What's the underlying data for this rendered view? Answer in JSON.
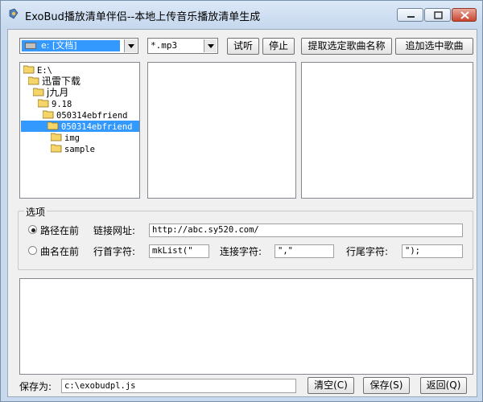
{
  "window": {
    "title": "ExoBud播放清单伴侣--本地上传音乐播放清单生成"
  },
  "toolbar": {
    "drive_value": "e: [文档]",
    "filter_value": "*.mp3",
    "play_label": "试听",
    "stop_label": "停止",
    "extract_label": "提取选定歌曲名称",
    "append_label": "追加选中歌曲"
  },
  "tree": {
    "items": [
      {
        "label": "E:\\"
      },
      {
        "label": "迅雷下载"
      },
      {
        "label": "j九月"
      },
      {
        "label": "9.18"
      },
      {
        "label": "050314ebfriend"
      },
      {
        "label": "050314ebfriend"
      },
      {
        "label": "img"
      },
      {
        "label": "sample"
      }
    ],
    "selected_index": 5
  },
  "options": {
    "legend": "选项",
    "radio_path_first": "路径在前",
    "radio_name_first": "曲名在前",
    "selected_radio": "路径在前",
    "link_label": "链接网址:",
    "link_value": "http://abc.sy520.com/",
    "line_start_label": "行首字符:",
    "line_start_value": "mkList(\"",
    "join_label": "连接字符:",
    "join_value": "\",\"",
    "line_end_label": "行尾字符:",
    "line_end_value": "\");"
  },
  "footer": {
    "save_as_label": "保存为:",
    "save_as_value": "c:\\exobudpl.js",
    "clear_label": "清空(C)",
    "save_label": "保存(S)",
    "back_label": "返回(Q)"
  },
  "colors": {
    "selection": "#3399ff",
    "titlebar": "#c6d8ee",
    "client": "#f0f0f0"
  }
}
